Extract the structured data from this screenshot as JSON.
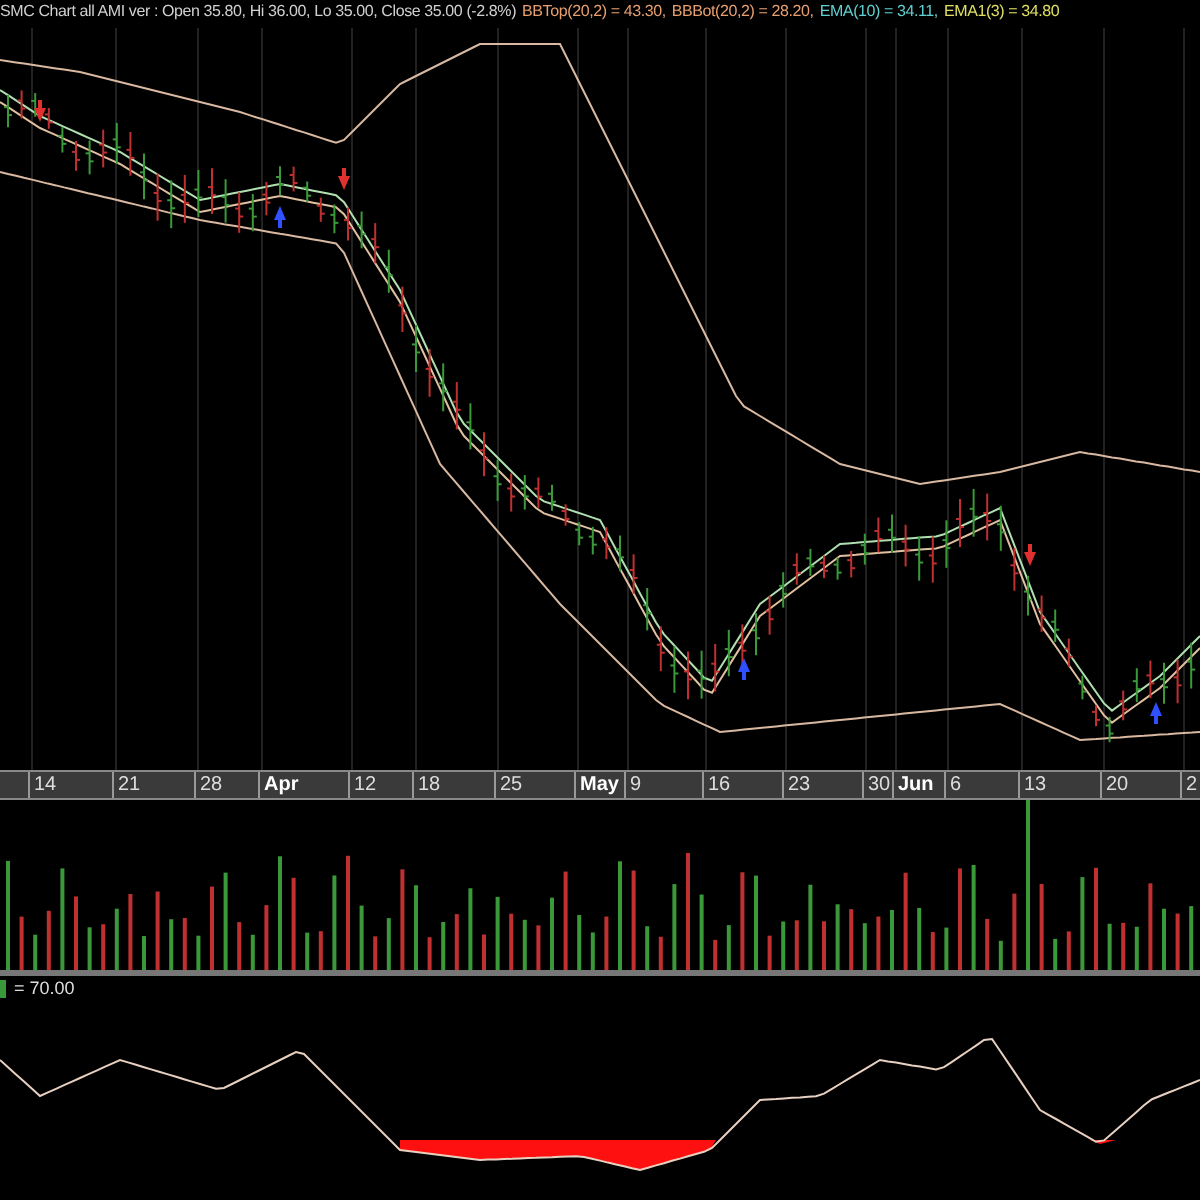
{
  "chart_title": "SMC Chart all AMI ver : Open 35.80, Hi 36.00, Lo 35.00, Close 35.00 (-2.8%)",
  "legend": [
    {
      "text": "BBTop(20,2) = 43.30,",
      "color": "#e8a070"
    },
    {
      "text": "BBBot(20,2) = 28.20,",
      "color": "#e8a070"
    },
    {
      "text": "EMA(10) = 34.11,",
      "color": "#60d0d0"
    },
    {
      "text": "EMA1(3) = 34.80",
      "color": "#e0e060"
    }
  ],
  "x_axis": [
    {
      "label": "14",
      "kind": "day"
    },
    {
      "label": "21",
      "kind": "day"
    },
    {
      "label": "28",
      "kind": "day"
    },
    {
      "label": "Apr",
      "kind": "month"
    },
    {
      "label": "12",
      "kind": "day"
    },
    {
      "label": "18",
      "kind": "day"
    },
    {
      "label": "25",
      "kind": "day"
    },
    {
      "label": "May",
      "kind": "month"
    },
    {
      "label": "9",
      "kind": "day"
    },
    {
      "label": "16",
      "kind": "day"
    },
    {
      "label": "23",
      "kind": "day"
    },
    {
      "label": "30",
      "kind": "day"
    },
    {
      "label": "Jun",
      "kind": "month"
    },
    {
      "label": "6",
      "kind": "day"
    },
    {
      "label": "13",
      "kind": "day"
    },
    {
      "label": "20",
      "kind": "day"
    },
    {
      "label": "2",
      "kind": "day"
    }
  ],
  "oscillator": {
    "label": "= 70.00"
  }
}
